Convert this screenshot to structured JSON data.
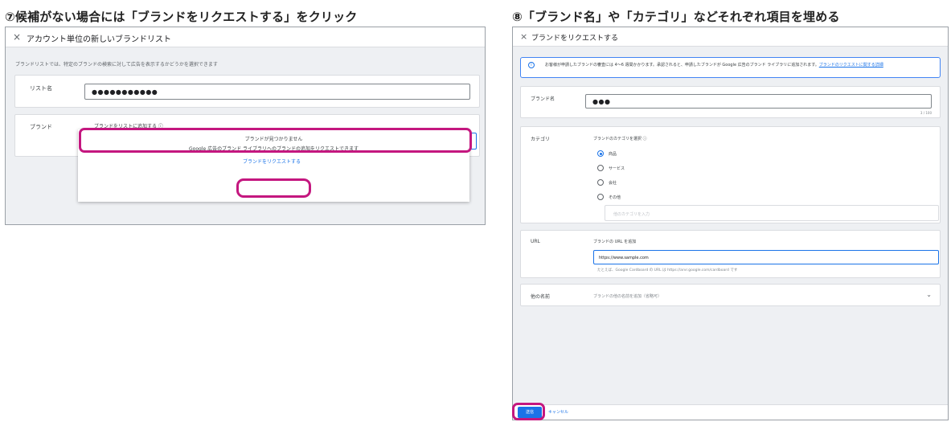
{
  "steps": {
    "left_title": "⑦候補がない場合には「ブランドをリクエストする」をクリック",
    "right_title": "⑧「ブランド名」や「カテゴリ」などそれぞれ項目を埋める"
  },
  "left_panel": {
    "close_icon": "×",
    "title": "アカウント単位の新しいブランドリスト",
    "description": "ブランドリストでは、特定のブランドの検索に対して広告を表示するかどうかを選択できます",
    "list_name_label": "リスト名",
    "list_name_value": "●●●●●●●●●●●",
    "brand_label": "ブランド",
    "brand_sub_label": "ブランドをリストに追加する ⓘ",
    "dropdown": {
      "not_found": "ブランドが見つかりません",
      "request_note": "Google 広告のブランド ライブラリへのブランドの追加をリクエストできます",
      "request_link": "ブランドをリクエストする"
    }
  },
  "right_panel": {
    "close_icon": "×",
    "title": "ブランドをリクエストする",
    "info": {
      "icon": "i",
      "text": "お客様が申請したブランドの審査には 4～6 週間かかります。承認されると、申請したブランドが Google 広告のブランド ライブラリに追加されます。",
      "link": "ブランドのリクエストに関する詳細"
    },
    "brand_name_label": "ブランド名",
    "brand_name_value": "●●●",
    "brand_name_counter": "3 / 100",
    "category_label": "カテゴリ",
    "category_sub_label": "ブランドのカテゴリを選択 ⓘ",
    "category_options": [
      {
        "label": "商品",
        "checked": true
      },
      {
        "label": "サービス",
        "checked": false
      },
      {
        "label": "会社",
        "checked": false
      },
      {
        "label": "その他",
        "checked": false
      }
    ],
    "other_category_placeholder": "他のカテゴリを入力",
    "url_label": "URL",
    "url_sub_label": "ブランドの URL を追加",
    "url_value": "https://www.sample.com",
    "url_hint": "たとえば、Google Cardboard の URL は https://arvr.google.com/cardboard です",
    "other_names_label": "他の名前",
    "other_names_placeholder": "ブランドの他の名前を追加（省略可）",
    "chevron_icon": "⌄",
    "send_button": "送信",
    "cancel_button": "キャンセル"
  },
  "colors": {
    "highlight": "#c4177f",
    "accent": "#1a73e8",
    "panel_bg": "#eef0f3"
  }
}
